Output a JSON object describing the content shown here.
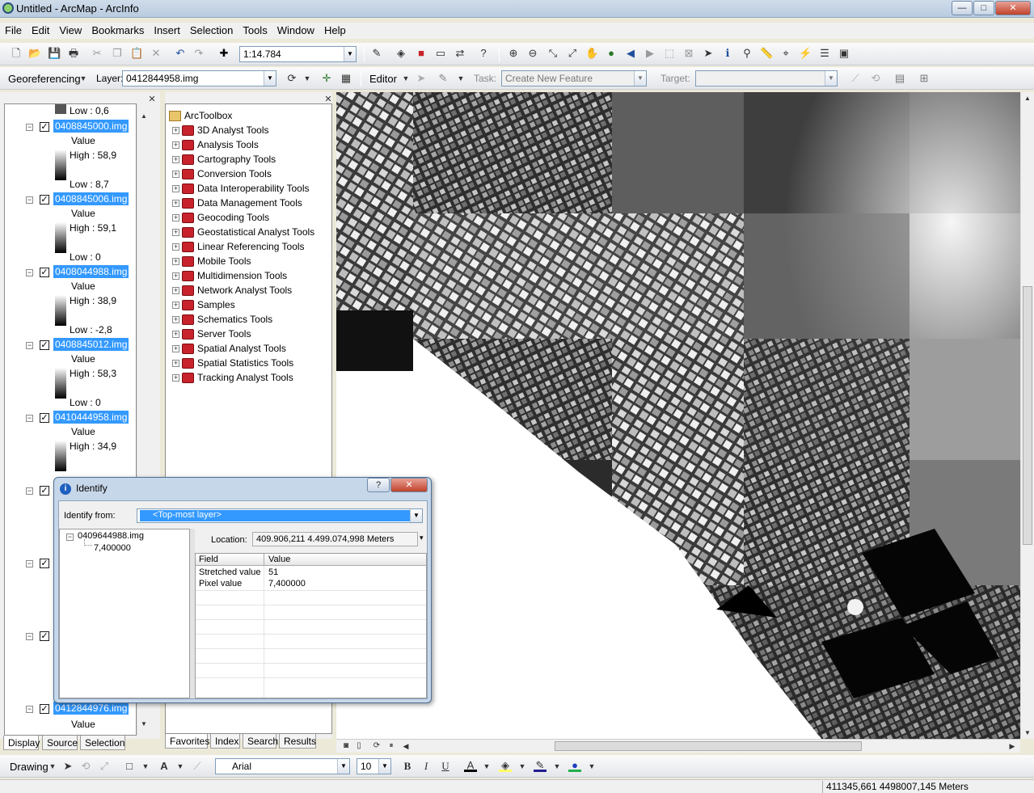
{
  "window": {
    "title": "Untitled - ArcMap - ArcInfo",
    "minimize": "—",
    "maximize": "□",
    "close": "✕"
  },
  "menu": [
    "File",
    "Edit",
    "View",
    "Bookmarks",
    "Insert",
    "Selection",
    "Tools",
    "Window",
    "Help"
  ],
  "standard_toolbar": {
    "scale": "1:14.784"
  },
  "georef_toolbar": {
    "georeferencing_label": "Georeferencing",
    "layer_label": "Layer:",
    "layer_value": "0412844958.img",
    "editor_label": "Editor",
    "task_label": "Task:",
    "task_value": "Create New Feature",
    "target_label": "Target:",
    "target_value": ""
  },
  "toc": {
    "top_low": "Low : 0,6",
    "layers": [
      {
        "name": "0408845000.img",
        "value_label": "Value",
        "high": "High : 58,9",
        "low": "Low : 8,7"
      },
      {
        "name": "0408845006.img",
        "value_label": "Value",
        "high": "High : 59,1",
        "low": "Low : 0"
      },
      {
        "name": "0408044988.img",
        "value_label": "Value",
        "high": "High : 38,9",
        "low": "Low : -2,8"
      },
      {
        "name": "0408845012.img",
        "value_label": "Value",
        "high": "High : 58,3",
        "low": "Low : 0"
      },
      {
        "name": "0410444958.img",
        "value_label": "Value",
        "high": "High : 34,9",
        "low": ""
      }
    ],
    "bottom_layer": {
      "name": "0412844976.img",
      "value_label": "Value"
    },
    "tabs": [
      "Display",
      "Source",
      "Selection"
    ]
  },
  "toolbox": {
    "root": "ArcToolbox",
    "tools": [
      "3D Analyst Tools",
      "Analysis Tools",
      "Cartography Tools",
      "Conversion Tools",
      "Data Interoperability Tools",
      "Data Management Tools",
      "Geocoding Tools",
      "Geostatistical Analyst Tools",
      "Linear Referencing Tools",
      "Mobile Tools",
      "Multidimension Tools",
      "Network Analyst Tools",
      "Samples",
      "Schematics Tools",
      "Server Tools",
      "Spatial Analyst Tools",
      "Spatial Statistics Tools",
      "Tracking Analyst Tools"
    ],
    "tabs": [
      "Favorites",
      "Index",
      "Search",
      "Results"
    ]
  },
  "identify": {
    "title": "Identify",
    "help": "?",
    "close": "✕",
    "identify_from_label": "Identify from:",
    "identify_from_value": "<Top-most layer>",
    "tree_layer": "0409644988.img",
    "tree_value": "7,400000",
    "location_label": "Location:",
    "location_value": "409.906,211  4.499.074,998 Meters",
    "columns": [
      "Field",
      "Value"
    ],
    "rows": [
      {
        "field": "Stretched value",
        "value": "51"
      },
      {
        "field": "Pixel value",
        "value": "7,400000"
      }
    ]
  },
  "drawing_toolbar": {
    "drawing_label": "Drawing",
    "font": "Arial",
    "size": "10",
    "bold": "B",
    "italic": "I",
    "underline": "U"
  },
  "status": {
    "coords": "411345,661  4498007,145 Meters"
  }
}
